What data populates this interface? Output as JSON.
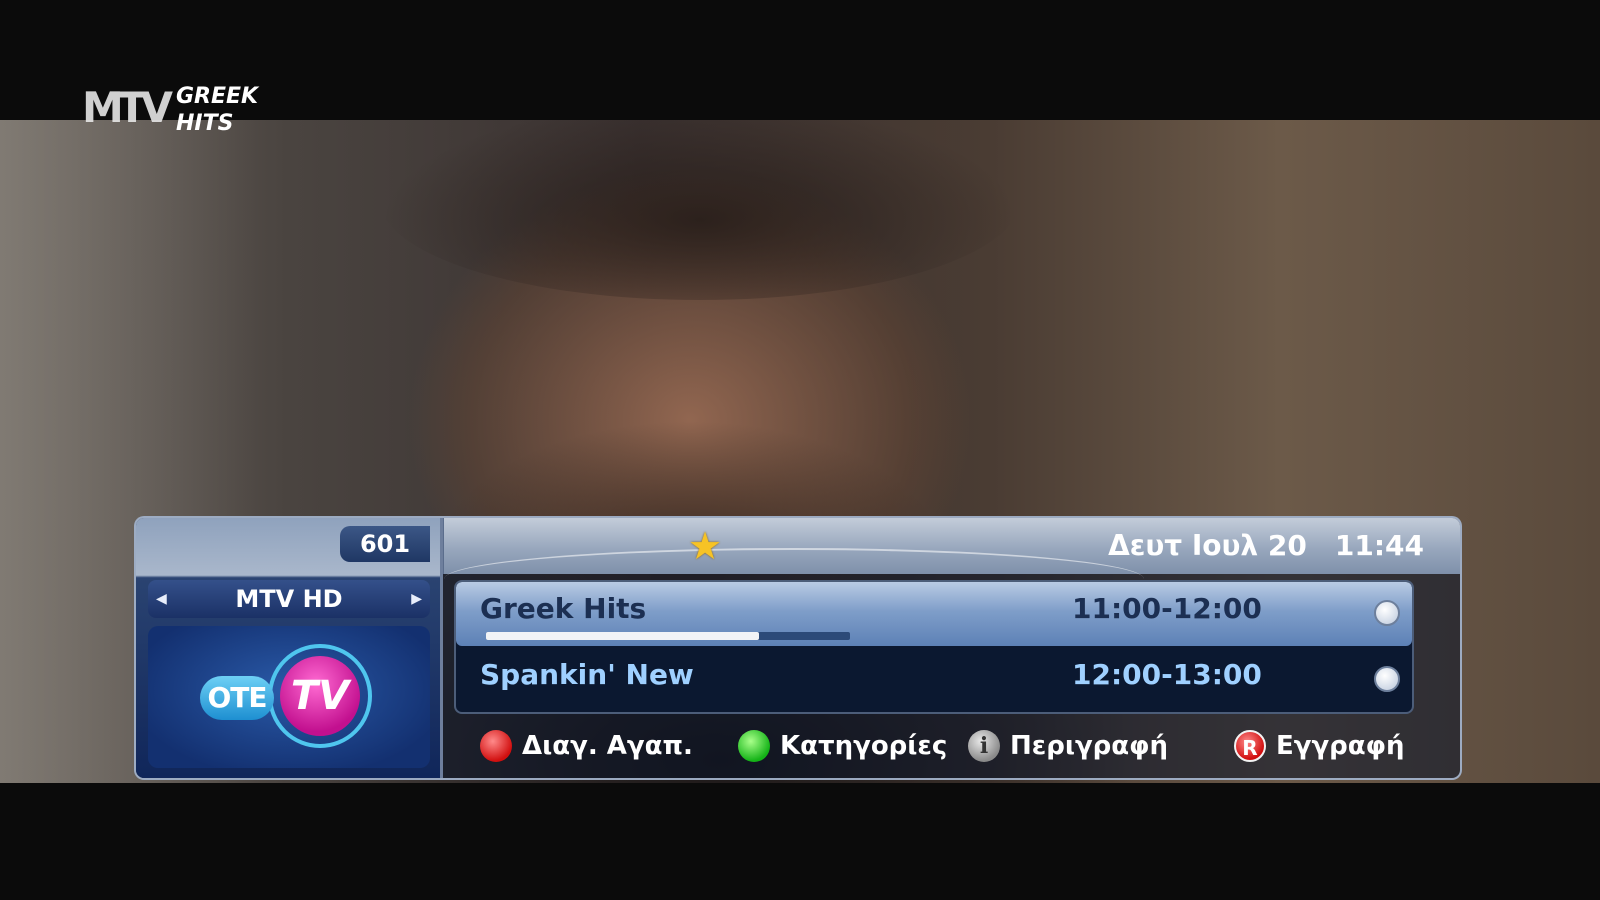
{
  "channel_logo": {
    "mark": "MTV",
    "line1": "GREEK",
    "line2": "HITS"
  },
  "infobar": {
    "channel_number": "601",
    "channel_name": "MTV HD",
    "provider_logo": {
      "ote": "OTE",
      "tv": "TV"
    },
    "favorite_icon": "star-icon",
    "date": "Δευτ Ιουλ 20",
    "time": "11:44",
    "programs": [
      {
        "title": "Greek Hits",
        "time": "11:00-12:00",
        "progress_percent": 75
      },
      {
        "title": "Spankin' New",
        "time": "12:00-13:00"
      }
    ],
    "buttons": [
      {
        "icon": "red-button-icon",
        "label": "Διαγ. Αγαπ."
      },
      {
        "icon": "green-button-icon",
        "label": "Κατηγορίες"
      },
      {
        "icon": "info-button-icon",
        "glyph": "i",
        "label": "Περιγραφή"
      },
      {
        "icon": "record-button-icon",
        "glyph": "R",
        "label": "Εγγραφή"
      }
    ]
  },
  "colors": {
    "accent_blue": "#1f3764",
    "selected_row": "#7f9ec9",
    "star": "#f7c325"
  }
}
